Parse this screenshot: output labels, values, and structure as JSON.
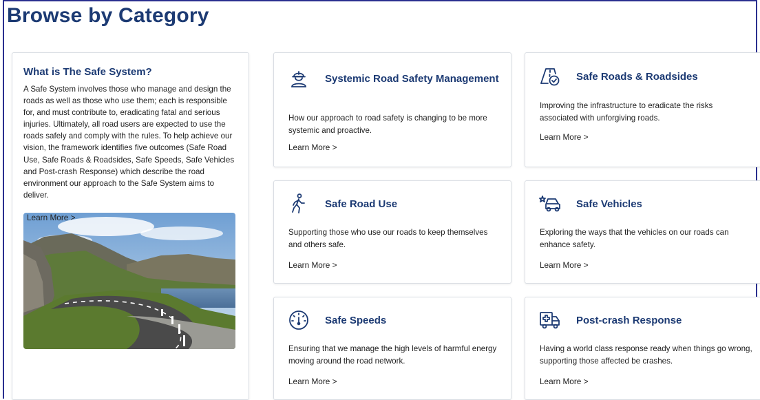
{
  "page_title": "Browse by Category",
  "intro": {
    "heading": "What is The Safe System?",
    "body": "A Safe System involves those who manage and design the roads as well as those who use them; each is responsible for, and must contribute to, eradicating fatal and serious injuries. Ultimately, all road users are expected to use the roads safely and comply with the rules. To help achieve our vision, the framework identifies five outcomes (Safe Road Use, Safe Roads & Roadsides, Safe Speeds, Safe Vehicles and Post-crash Response) which describe the road environment our approach to the Safe System aims to deliver.",
    "link": "Learn More >"
  },
  "categories": [
    {
      "title": "Systemic Road Safety Management",
      "desc": "How our approach to road safety is changing to be more systemic and proactive.",
      "link": "Learn More >",
      "icon": "road-worker-icon"
    },
    {
      "title": "Safe Roads & Roadsides",
      "desc": "Improving the infrastructure to eradicate the risks associated with unforgiving roads.",
      "link": "Learn More >",
      "icon": "road-check-icon"
    },
    {
      "title": "Safe Road Use",
      "desc": "Supporting those who use our roads to keep themselves and others safe.",
      "link": "Learn More >",
      "icon": "pedestrian-icon"
    },
    {
      "title": "Safe Vehicles",
      "desc": "Exploring the ways that the vehicles on our roads can enhance safety.",
      "link": "Learn More >",
      "icon": "car-icon"
    },
    {
      "title": "Safe Speeds",
      "desc": "Ensuring that we manage the high levels of harmful energy moving around the road network.",
      "link": "Learn More >",
      "icon": "speedometer-icon"
    },
    {
      "title": "Post-crash Response",
      "desc": "Having a world class response ready when things go wrong, supporting those affected be crashes.",
      "link": "Learn More >",
      "icon": "ambulance-icon"
    }
  ],
  "colors": {
    "heading": "#1c3a73",
    "border": "#2a2f8f",
    "card_border": "#d9dde3"
  }
}
